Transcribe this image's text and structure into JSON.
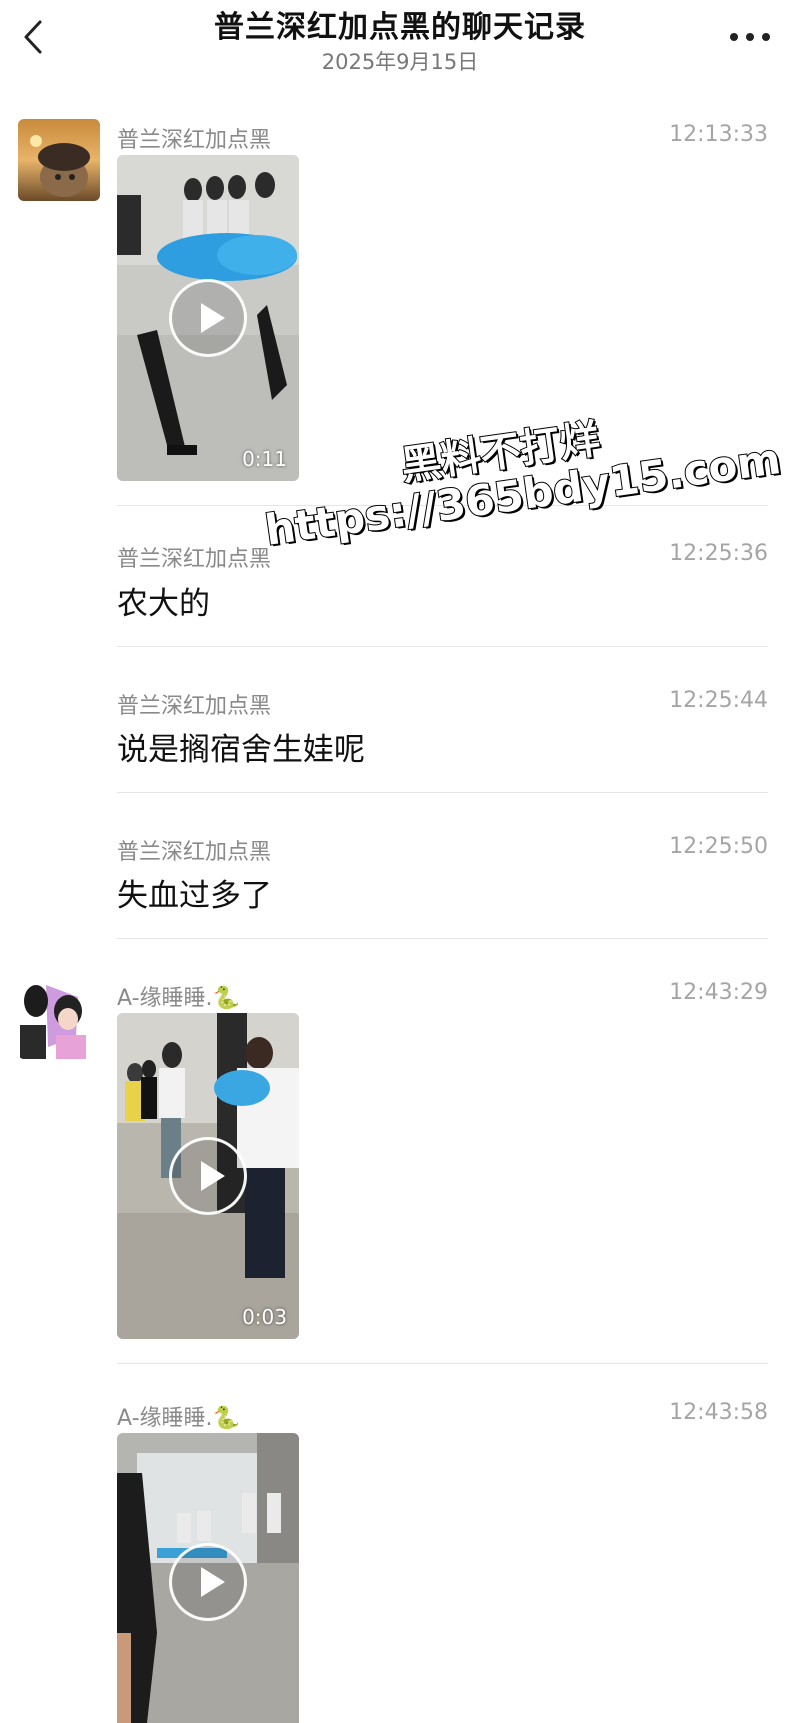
{
  "header": {
    "title": "普兰深红加点黑的聊天记录",
    "date": "2025年9月15日",
    "back_icon": "chevron-left-icon",
    "more_icon": "more-dots-icon"
  },
  "messages": [
    {
      "sender": "普兰深红加点黑",
      "time": "12:13:33",
      "type": "video",
      "duration": "0:11"
    },
    {
      "sender": "普兰深红加点黑",
      "time": "12:25:36",
      "type": "text",
      "text": "农大的"
    },
    {
      "sender": "普兰深红加点黑",
      "time": "12:25:44",
      "type": "text",
      "text": "说是搁宿舍生娃呢"
    },
    {
      "sender": "普兰深红加点黑",
      "time": "12:25:50",
      "type": "text",
      "text": "失血过多了"
    },
    {
      "sender": "A-缘睡睡.🐍",
      "time": "12:43:29",
      "type": "video",
      "duration": "0:03"
    },
    {
      "sender": "A-缘睡睡.🐍",
      "time": "12:43:58",
      "type": "video",
      "duration": ""
    }
  ],
  "watermark": {
    "line1": "黑料不打烊",
    "line2": "https://365bdy15.com"
  }
}
